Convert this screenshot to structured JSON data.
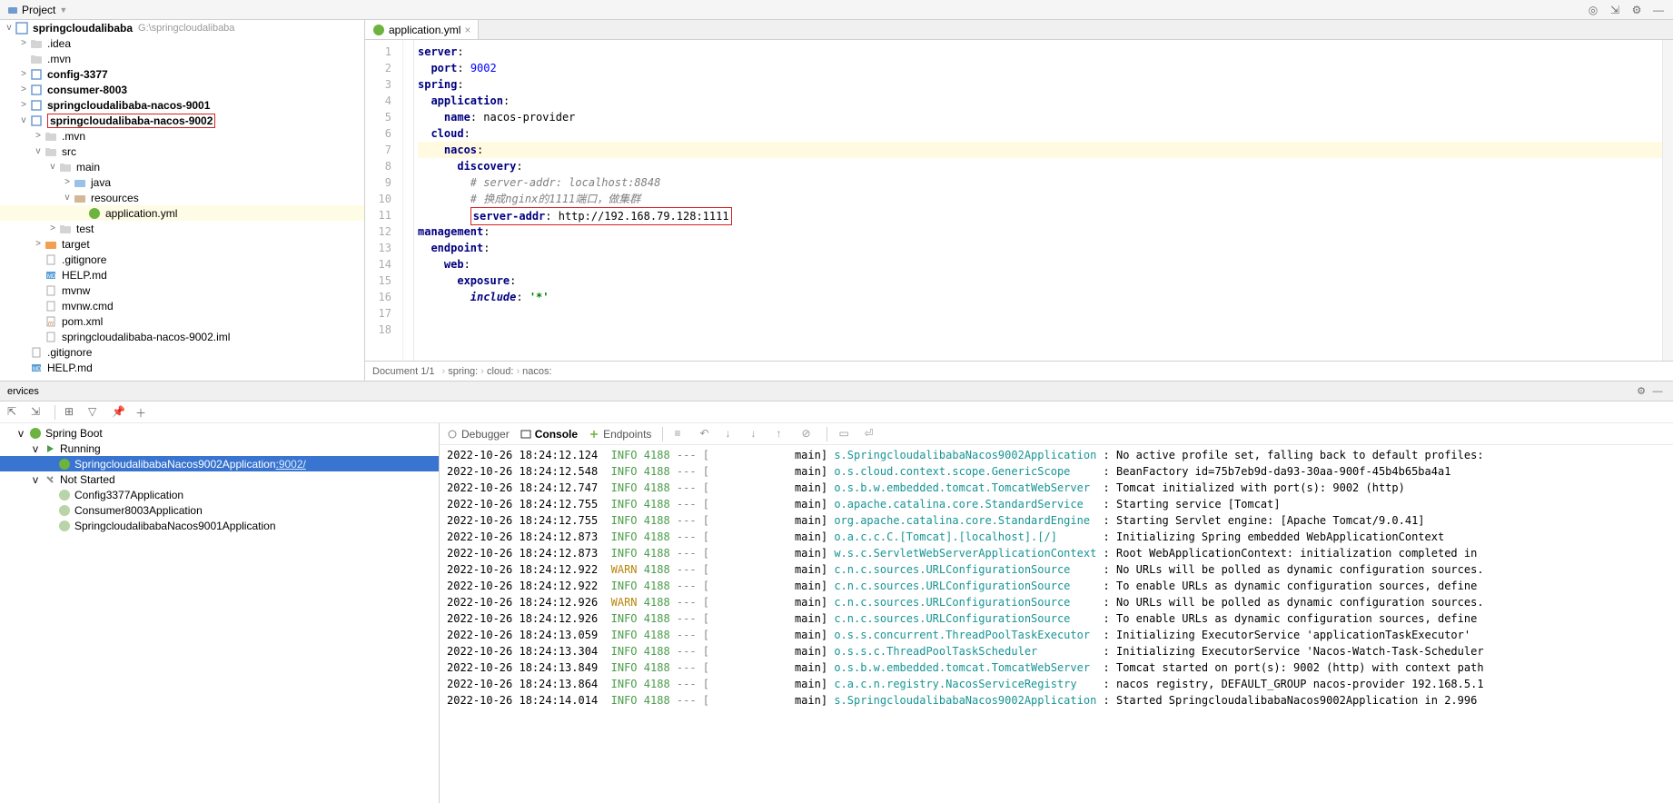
{
  "toolbar": {
    "project_label": "Project"
  },
  "project_root": {
    "name": "springcloudalibaba",
    "path": "G:\\springcloudalibaba"
  },
  "tree": [
    {
      "indent": 1,
      "arrow": ">",
      "icon": "folder",
      "label": ".idea"
    },
    {
      "indent": 1,
      "arrow": "",
      "icon": "folder",
      "label": ".mvn"
    },
    {
      "indent": 1,
      "arrow": ">",
      "icon": "module",
      "label": "config-3377",
      "bold": true
    },
    {
      "indent": 1,
      "arrow": ">",
      "icon": "module",
      "label": "consumer-8003",
      "bold": true
    },
    {
      "indent": 1,
      "arrow": ">",
      "icon": "module",
      "label": "springcloudalibaba-nacos-9001",
      "bold": true
    },
    {
      "indent": 1,
      "arrow": "v",
      "icon": "module",
      "label": "springcloudalibaba-nacos-9002",
      "bold": true,
      "boxed": true
    },
    {
      "indent": 2,
      "arrow": ">",
      "icon": "folder",
      "label": ".mvn"
    },
    {
      "indent": 2,
      "arrow": "v",
      "icon": "folder",
      "label": "src"
    },
    {
      "indent": 3,
      "arrow": "v",
      "icon": "folder",
      "label": "main"
    },
    {
      "indent": 4,
      "arrow": ">",
      "icon": "folder-src",
      "label": "java"
    },
    {
      "indent": 4,
      "arrow": "v",
      "icon": "folder-res",
      "label": "resources"
    },
    {
      "indent": 5,
      "arrow": "",
      "icon": "yml",
      "label": "application.yml",
      "hl": true
    },
    {
      "indent": 3,
      "arrow": ">",
      "icon": "folder",
      "label": "test"
    },
    {
      "indent": 2,
      "arrow": ">",
      "icon": "folder-target",
      "label": "target"
    },
    {
      "indent": 2,
      "arrow": "",
      "icon": "file",
      "label": ".gitignore"
    },
    {
      "indent": 2,
      "arrow": "",
      "icon": "md",
      "label": "HELP.md"
    },
    {
      "indent": 2,
      "arrow": "",
      "icon": "file",
      "label": "mvnw"
    },
    {
      "indent": 2,
      "arrow": "",
      "icon": "file",
      "label": "mvnw.cmd"
    },
    {
      "indent": 2,
      "arrow": "",
      "icon": "pom",
      "label": "pom.xml"
    },
    {
      "indent": 2,
      "arrow": "",
      "icon": "file",
      "label": "springcloudalibaba-nacos-9002.iml"
    },
    {
      "indent": 1,
      "arrow": "",
      "icon": "file",
      "label": ".gitignore"
    },
    {
      "indent": 1,
      "arrow": "",
      "icon": "md",
      "label": "HELP.md"
    }
  ],
  "editor": {
    "tab_name": "application.yml",
    "lines": [
      {
        "n": 1,
        "segs": [
          {
            "t": "server",
            "c": "kw"
          },
          {
            "t": ":",
            "c": ""
          }
        ]
      },
      {
        "n": 2,
        "segs": [
          {
            "t": "  ",
            "c": ""
          },
          {
            "t": "port",
            "c": "kw"
          },
          {
            "t": ": ",
            "c": ""
          },
          {
            "t": "9002",
            "c": "num"
          }
        ]
      },
      {
        "n": 3,
        "segs": [
          {
            "t": "spring",
            "c": "kw"
          },
          {
            "t": ":",
            "c": ""
          }
        ]
      },
      {
        "n": 4,
        "segs": [
          {
            "t": "  ",
            "c": ""
          },
          {
            "t": "application",
            "c": "kw"
          },
          {
            "t": ":",
            "c": ""
          }
        ]
      },
      {
        "n": 5,
        "segs": [
          {
            "t": "    ",
            "c": ""
          },
          {
            "t": "name",
            "c": "kw"
          },
          {
            "t": ": nacos-provider",
            "c": ""
          }
        ]
      },
      {
        "n": 6,
        "segs": [
          {
            "t": "  ",
            "c": ""
          },
          {
            "t": "cloud",
            "c": "kw"
          },
          {
            "t": ":",
            "c": ""
          }
        ]
      },
      {
        "n": 7,
        "hl": true,
        "segs": [
          {
            "t": "    ",
            "c": ""
          },
          {
            "t": "nacos",
            "c": "kw"
          },
          {
            "t": ":",
            "c": ""
          }
        ]
      },
      {
        "n": 8,
        "segs": [
          {
            "t": "      ",
            "c": ""
          },
          {
            "t": "discovery",
            "c": "kw"
          },
          {
            "t": ":",
            "c": ""
          }
        ]
      },
      {
        "n": 9,
        "segs": [
          {
            "t": "        ",
            "c": ""
          },
          {
            "t": "# server-addr: localhost:8848",
            "c": "comment"
          }
        ]
      },
      {
        "n": 10,
        "segs": [
          {
            "t": "        ",
            "c": ""
          },
          {
            "t": "# 换成nginx的1111端口，做集群",
            "c": "comment"
          }
        ]
      },
      {
        "n": 11,
        "segs": [
          {
            "t": "        ",
            "c": ""
          }
        ],
        "boxed_segs": [
          {
            "t": "server-addr",
            "c": "kw"
          },
          {
            "t": ": http://192.168.79.128:1111",
            "c": ""
          }
        ]
      },
      {
        "n": 12,
        "segs": [
          {
            "t": "management",
            "c": "kw"
          },
          {
            "t": ":",
            "c": ""
          }
        ]
      },
      {
        "n": 13,
        "segs": [
          {
            "t": "  ",
            "c": ""
          },
          {
            "t": "endpoint",
            "c": "kw"
          },
          {
            "t": ":",
            "c": ""
          }
        ]
      },
      {
        "n": 14,
        "segs": [
          {
            "t": "    ",
            "c": ""
          },
          {
            "t": "web",
            "c": "kw"
          },
          {
            "t": ":",
            "c": ""
          }
        ]
      },
      {
        "n": 15,
        "segs": [
          {
            "t": "      ",
            "c": ""
          },
          {
            "t": "exposure",
            "c": "kw"
          },
          {
            "t": ":",
            "c": ""
          }
        ]
      },
      {
        "n": 16,
        "segs": [
          {
            "t": "        ",
            "c": ""
          },
          {
            "t": "include",
            "c": "kw inc"
          },
          {
            "t": ": ",
            "c": ""
          },
          {
            "t": "'*'",
            "c": "str"
          }
        ]
      },
      {
        "n": 17,
        "segs": [
          {
            "t": "",
            "c": ""
          }
        ]
      },
      {
        "n": 18,
        "segs": [
          {
            "t": "",
            "c": ""
          }
        ]
      }
    ]
  },
  "breadcrumb": {
    "doc": "Document 1/1",
    "parts": [
      "spring:",
      "cloud:",
      "nacos:"
    ]
  },
  "services": {
    "title": "ervices",
    "tree": [
      {
        "indent": 0,
        "arrow": "v",
        "icon": "spring",
        "label": "Spring Boot"
      },
      {
        "indent": 1,
        "arrow": "v",
        "icon": "run",
        "label": "Running"
      },
      {
        "indent": 2,
        "arrow": "",
        "icon": "spring",
        "label": "SpringcloudalibabaNacos9002Application",
        "port": ":9002/",
        "selected": true
      },
      {
        "indent": 1,
        "arrow": "v",
        "icon": "wrench",
        "label": "Not Started"
      },
      {
        "indent": 2,
        "arrow": "",
        "icon": "spring-off",
        "label": "Config3377Application"
      },
      {
        "indent": 2,
        "arrow": "",
        "icon": "spring-off",
        "label": "Consumer8003Application"
      },
      {
        "indent": 2,
        "arrow": "",
        "icon": "spring-off",
        "label": "SpringcloudalibabaNacos9001Application"
      }
    ],
    "tabs": {
      "debugger": "Debugger",
      "console": "Console",
      "endpoints": "Endpoints"
    },
    "logs": [
      {
        "ts": "2022-10-26 18:24:12.124",
        "lv": "INFO",
        "pid": "4188",
        "th": "main]",
        "cls": "s.SpringcloudalibabaNacos9002Application",
        "msg": "No active profile set, falling back to default profiles:"
      },
      {
        "ts": "2022-10-26 18:24:12.548",
        "lv": "INFO",
        "pid": "4188",
        "th": "main]",
        "cls": "o.s.cloud.context.scope.GenericScope    ",
        "msg": "BeanFactory id=75b7eb9d-da93-30aa-900f-45b4b65ba4a1"
      },
      {
        "ts": "2022-10-26 18:24:12.747",
        "lv": "INFO",
        "pid": "4188",
        "th": "main]",
        "cls": "o.s.b.w.embedded.tomcat.TomcatWebServer ",
        "msg": "Tomcat initialized with port(s): 9002 (http)"
      },
      {
        "ts": "2022-10-26 18:24:12.755",
        "lv": "INFO",
        "pid": "4188",
        "th": "main]",
        "cls": "o.apache.catalina.core.StandardService  ",
        "msg": "Starting service [Tomcat]"
      },
      {
        "ts": "2022-10-26 18:24:12.755",
        "lv": "INFO",
        "pid": "4188",
        "th": "main]",
        "cls": "org.apache.catalina.core.StandardEngine ",
        "msg": "Starting Servlet engine: [Apache Tomcat/9.0.41]"
      },
      {
        "ts": "2022-10-26 18:24:12.873",
        "lv": "INFO",
        "pid": "4188",
        "th": "main]",
        "cls": "o.a.c.c.C.[Tomcat].[localhost].[/]      ",
        "msg": "Initializing Spring embedded WebApplicationContext"
      },
      {
        "ts": "2022-10-26 18:24:12.873",
        "lv": "INFO",
        "pid": "4188",
        "th": "main]",
        "cls": "w.s.c.ServletWebServerApplicationContext",
        "msg": "Root WebApplicationContext: initialization completed in "
      },
      {
        "ts": "2022-10-26 18:24:12.922",
        "lv": "WARN",
        "pid": "4188",
        "th": "main]",
        "cls": "c.n.c.sources.URLConfigurationSource    ",
        "msg": "No URLs will be polled as dynamic configuration sources."
      },
      {
        "ts": "2022-10-26 18:24:12.922",
        "lv": "INFO",
        "pid": "4188",
        "th": "main]",
        "cls": "c.n.c.sources.URLConfigurationSource    ",
        "msg": "To enable URLs as dynamic configuration sources, define "
      },
      {
        "ts": "2022-10-26 18:24:12.926",
        "lv": "WARN",
        "pid": "4188",
        "th": "main]",
        "cls": "c.n.c.sources.URLConfigurationSource    ",
        "msg": "No URLs will be polled as dynamic configuration sources."
      },
      {
        "ts": "2022-10-26 18:24:12.926",
        "lv": "INFO",
        "pid": "4188",
        "th": "main]",
        "cls": "c.n.c.sources.URLConfigurationSource    ",
        "msg": "To enable URLs as dynamic configuration sources, define "
      },
      {
        "ts": "2022-10-26 18:24:13.059",
        "lv": "INFO",
        "pid": "4188",
        "th": "main]",
        "cls": "o.s.s.concurrent.ThreadPoolTaskExecutor ",
        "msg": "Initializing ExecutorService 'applicationTaskExecutor'"
      },
      {
        "ts": "2022-10-26 18:24:13.304",
        "lv": "INFO",
        "pid": "4188",
        "th": "main]",
        "cls": "o.s.s.c.ThreadPoolTaskScheduler         ",
        "msg": "Initializing ExecutorService 'Nacos-Watch-Task-Scheduler"
      },
      {
        "ts": "2022-10-26 18:24:13.849",
        "lv": "INFO",
        "pid": "4188",
        "th": "main]",
        "cls": "o.s.b.w.embedded.tomcat.TomcatWebServer ",
        "msg": "Tomcat started on port(s): 9002 (http) with context path"
      },
      {
        "ts": "2022-10-26 18:24:13.864",
        "lv": "INFO",
        "pid": "4188",
        "th": "main]",
        "cls": "c.a.c.n.registry.NacosServiceRegistry   ",
        "msg": "nacos registry, DEFAULT_GROUP nacos-provider 192.168.5.1"
      },
      {
        "ts": "2022-10-26 18:24:14.014",
        "lv": "INFO",
        "pid": "4188",
        "th": "main]",
        "cls": "s.SpringcloudalibabaNacos9002Application",
        "msg": "Started SpringcloudalibabaNacos9002Application in 2.996"
      }
    ]
  }
}
